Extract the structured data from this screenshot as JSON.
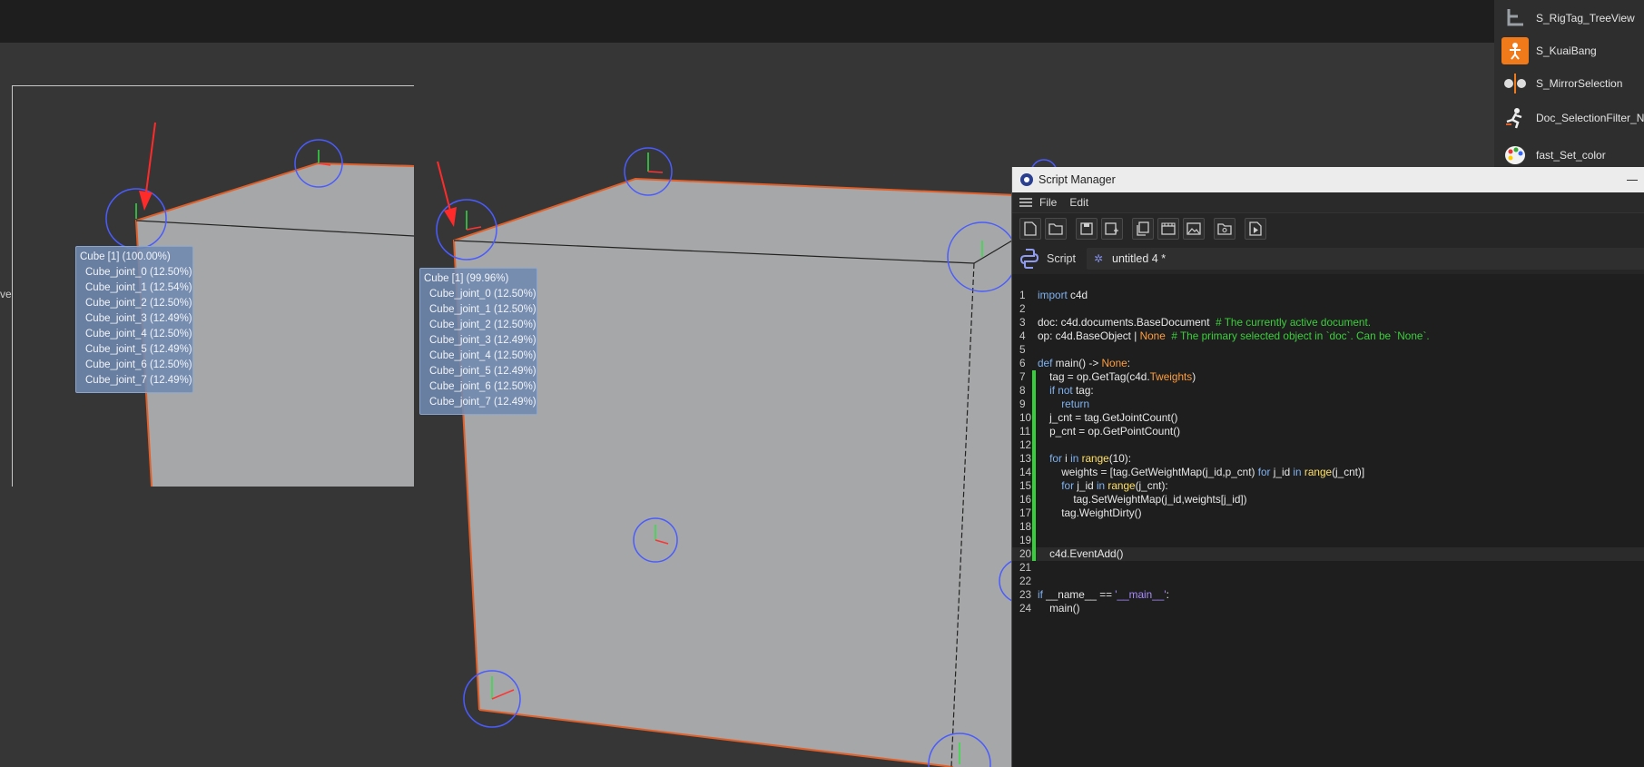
{
  "viewport": {
    "side_label": "ve",
    "tooltips": [
      {
        "title": "Cube [1] (100.00%)",
        "rows": [
          "Cube_joint_0 (12.50%)",
          "Cube_joint_1 (12.54%)",
          "Cube_joint_2 (12.50%)",
          "Cube_joint_3 (12.49%)",
          "Cube_joint_4 (12.50%)",
          "Cube_joint_5 (12.49%)",
          "Cube_joint_6 (12.50%)",
          "Cube_joint_7 (12.49%)"
        ]
      },
      {
        "title": "Cube [1] (99.96%)",
        "rows": [
          "Cube_joint_0 (12.50%)",
          "Cube_joint_1 (12.50%)",
          "Cube_joint_2 (12.50%)",
          "Cube_joint_3 (12.49%)",
          "Cube_joint_4 (12.50%)",
          "Cube_joint_5 (12.49%)",
          "Cube_joint_6 (12.50%)",
          "Cube_joint_7 (12.49%)"
        ]
      }
    ]
  },
  "script_list": {
    "items": [
      {
        "label": "S_RigTag_TreeView",
        "icon": "treeview-icon"
      },
      {
        "label": "S_KuaiBang",
        "icon": "figure-icon"
      },
      {
        "label": "S_MirrorSelection",
        "icon": "mirror-icon"
      },
      {
        "label": "Doc_SelectionFilter_Nu",
        "icon": "runner-icon"
      },
      {
        "label": "fast_Set_color",
        "icon": "palette-icon"
      }
    ]
  },
  "script_manager": {
    "title": "Script Manager",
    "menu": [
      "File",
      "Edit"
    ],
    "toolbar": [
      "new-file-icon",
      "open-folder-icon",
      "save-icon",
      "save-as-icon",
      "duplicate-icon",
      "clapper-icon",
      "image-icon",
      "folder-search-icon",
      "execute-icon"
    ],
    "script_label": "Script",
    "script_name": "untitled 4 *",
    "accent": "#34d13a",
    "editor": {
      "active_line": 20,
      "lines": [
        [
          [
            "kw",
            "import"
          ],
          [
            "",
            " c4d"
          ]
        ],
        [],
        [
          [
            "",
            "doc: c4d.documents.BaseDocument  "
          ],
          [
            "cm",
            "# The currently active document."
          ]
        ],
        [
          [
            "",
            "op: c4d.BaseObject | "
          ],
          [
            "kw2",
            "None"
          ],
          [
            "",
            "  "
          ],
          [
            "cm",
            "# The primary selected object in `doc`. Can be `None`."
          ]
        ],
        [],
        [
          [
            "kw",
            "def"
          ],
          [
            "",
            " main() -> "
          ],
          [
            "kw2",
            "None"
          ],
          [
            "",
            ":"
          ]
        ],
        [
          [
            "",
            "    tag = op.GetTag(c4d."
          ],
          [
            "kw2",
            "Tweights"
          ],
          [
            "",
            ")"
          ]
        ],
        [
          [
            "",
            "    "
          ],
          [
            "kw",
            "if not"
          ],
          [
            "",
            " tag:"
          ]
        ],
        [
          [
            "",
            "        "
          ],
          [
            "kw",
            "return"
          ]
        ],
        [
          [
            "",
            "    j_cnt = tag.GetJointCount()"
          ]
        ],
        [
          [
            "",
            "    p_cnt = op.GetPointCount()"
          ]
        ],
        [],
        [
          [
            "",
            "    "
          ],
          [
            "kw",
            "for"
          ],
          [
            "",
            " i "
          ],
          [
            "kw",
            "in"
          ],
          [
            "",
            " "
          ],
          [
            "fn",
            "range"
          ],
          [
            "",
            "(10):"
          ]
        ],
        [
          [
            "",
            "        weights = [tag.GetWeightMap(j_id,p_cnt) "
          ],
          [
            "kw",
            "for"
          ],
          [
            "",
            " j_id "
          ],
          [
            "kw",
            "in"
          ],
          [
            "",
            " "
          ],
          [
            "fn",
            "range"
          ],
          [
            "",
            "(j_cnt)]"
          ]
        ],
        [
          [
            "",
            "        "
          ],
          [
            "kw",
            "for"
          ],
          [
            "",
            " j_id "
          ],
          [
            "kw",
            "in"
          ],
          [
            "",
            " "
          ],
          [
            "fn",
            "range"
          ],
          [
            "",
            "(j_cnt):"
          ]
        ],
        [
          [
            "",
            "            tag.SetWeightMap(j_id,weights[j_id])"
          ]
        ],
        [
          [
            "",
            "        tag.WeightDirty()"
          ]
        ],
        [],
        [],
        [
          [
            "",
            "    c4d.EventAdd()"
          ]
        ],
        [],
        [],
        [
          [
            "kw",
            "if"
          ],
          [
            "",
            " __name__ == "
          ],
          [
            "st",
            "'__main__'"
          ],
          [
            "",
            ":"
          ]
        ],
        [
          [
            "",
            "    main()"
          ]
        ]
      ]
    }
  }
}
